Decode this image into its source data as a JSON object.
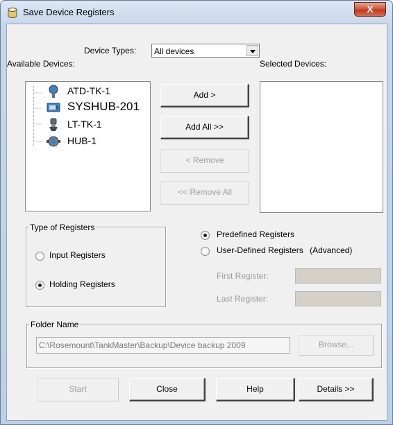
{
  "window": {
    "title": "Save Device Registers",
    "close_label": "X"
  },
  "device_types": {
    "label": "Device Types:",
    "value": "All devices"
  },
  "available": {
    "label": "Available Devices:",
    "items": [
      {
        "label": "ATD-TK-1",
        "icon": "temperature-transmitter-icon"
      },
      {
        "label": "SYSHUB-201",
        "icon": "system-hub-icon"
      },
      {
        "label": "LT-TK-1",
        "icon": "level-gauge-icon"
      },
      {
        "label": "HUB-1",
        "icon": "field-hub-icon"
      }
    ]
  },
  "selected": {
    "label": "Selected Devices:"
  },
  "transfer_buttons": {
    "add": "Add >",
    "add_all": "Add All >>",
    "remove": "< Remove",
    "remove_all": "<< Remove All"
  },
  "register_type": {
    "group_title": "Type of Registers",
    "input": "Input Registers",
    "holding": "Holding Registers",
    "selected": "holding"
  },
  "register_source": {
    "predefined": "Predefined Registers",
    "user_defined": "User-Defined Registers",
    "advanced": "(Advanced)",
    "selected": "predefined",
    "first_label": "First Register:",
    "last_label": "Last Register:"
  },
  "folder": {
    "group_title": "Folder Name",
    "path": "C:\\Rosemount\\TankMaster\\Backup\\Device backup 2009",
    "browse": "Browse..."
  },
  "footer": {
    "start": "Start",
    "close": "Close",
    "help": "Help",
    "details": "Details >>"
  }
}
